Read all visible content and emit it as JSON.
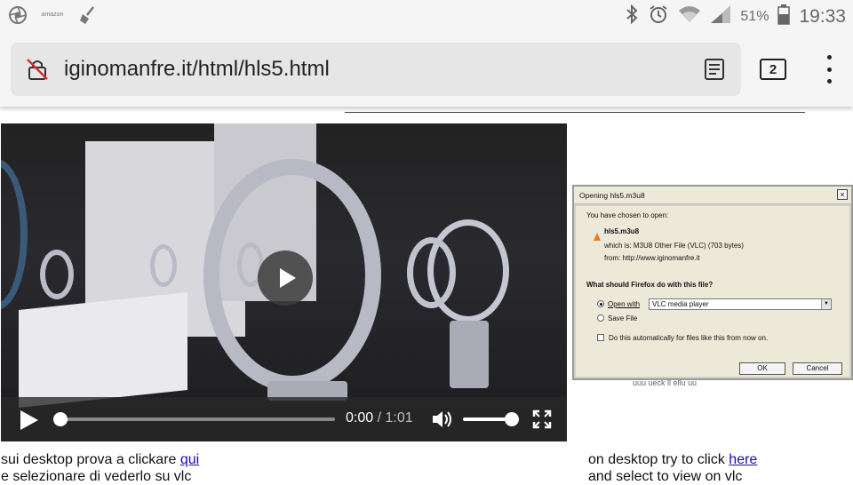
{
  "status_bar": {
    "amazon_label": "amazon",
    "battery_percent": "51%",
    "time": "19:33",
    "icons": [
      "aperture-icon",
      "amazon-icon",
      "broom-icon",
      "bluetooth-icon",
      "alarm-icon",
      "wifi-icon",
      "signal-icon",
      "battery-icon"
    ]
  },
  "browser": {
    "url": "iginomanfre.it/html/hls5.html",
    "tab_count": "2"
  },
  "video": {
    "current_time": "0:00",
    "separator": "/",
    "duration": "1:01",
    "progress": 0,
    "volume": 1.0
  },
  "dialog": {
    "title": "Opening hls5.m3u8",
    "chosen_text": "You have chosen to open:",
    "filename": "hls5.m3u8",
    "which_is": "which is: M3U8 Other File (VLC) (703 bytes)",
    "from": "from: http://www.iginomanfre.it",
    "question": "What should Firefox do with this file?",
    "open_with_label": "Open with",
    "open_with_value": "VLC media player",
    "save_file_label": "Save File",
    "auto_label": "Do this automatically for files like this from now on.",
    "ok_label": "OK",
    "cancel_label": "Cancel",
    "under_text": "uuu ueck ll ellu uu"
  },
  "text": {
    "it_line1_prefix": "sui desktop prova a clickare ",
    "it_link": "qui",
    "it_line2": "e selezionare di vederlo su vlc",
    "en_line1_prefix": "on desktop try to click ",
    "en_link": "here",
    "en_line2": "and select to view on vlc"
  }
}
